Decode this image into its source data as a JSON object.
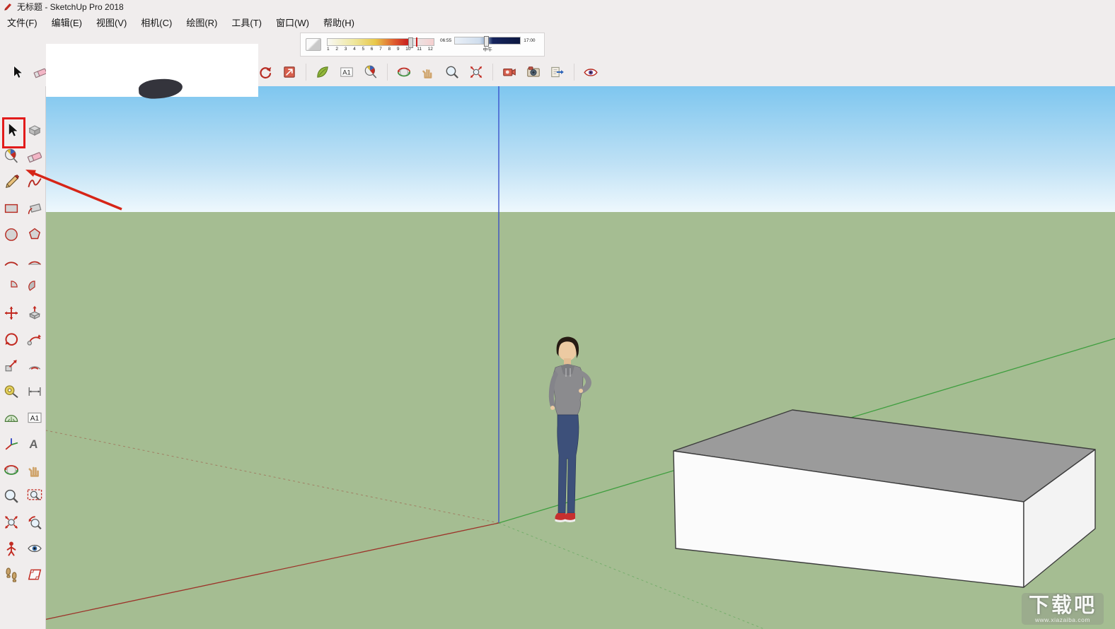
{
  "window": {
    "title": "无标题 - SketchUp Pro 2018"
  },
  "menu": {
    "items": [
      {
        "id": "file",
        "label": "文件(F)"
      },
      {
        "id": "edit",
        "label": "编辑(E)"
      },
      {
        "id": "view",
        "label": "视图(V)"
      },
      {
        "id": "camera",
        "label": "相机(C)"
      },
      {
        "id": "draw",
        "label": "绘图(R)"
      },
      {
        "id": "tools",
        "label": "工具(T)"
      },
      {
        "id": "window",
        "label": "窗口(W)"
      },
      {
        "id": "help",
        "label": "帮助(H)"
      }
    ]
  },
  "shadow_toolbar": {
    "months": [
      "1",
      "2",
      "3",
      "4",
      "5",
      "6",
      "7",
      "8",
      "9",
      "10",
      "11",
      "12"
    ],
    "time_start": "06:55",
    "noon_label": "中午",
    "time_end": "17:00"
  },
  "top_toolbar": {
    "icons": [
      "select",
      "eraser",
      "--",
      "redo",
      "export-box",
      "|",
      "leaf",
      "text-a1",
      "bucket",
      "|",
      "orbit",
      "pan",
      "zoom",
      "zoom-extents",
      "|",
      "camera-red",
      "camera-face",
      "export-arrow",
      "|",
      "eye"
    ]
  },
  "left_toolbar": {
    "rows": [
      [
        "select",
        "component"
      ],
      [
        "bucket",
        "eraser"
      ],
      [
        "pencil",
        "freehand"
      ],
      [
        "rect",
        "rotated-rect"
      ],
      [
        "circle",
        "polygon"
      ],
      [
        "arc",
        "arc2"
      ],
      [
        "pie",
        "pie2"
      ],
      [
        "move",
        "push-pull"
      ],
      [
        "rotate",
        "follow-me"
      ],
      [
        "scale",
        "offset"
      ],
      [
        "tape",
        "dimension"
      ],
      [
        "protractor",
        "text-a1"
      ],
      [
        "axes",
        "text-3d"
      ],
      [
        "orbit",
        "pan"
      ],
      [
        "zoom",
        "zoom-window"
      ],
      [
        "zoom-extents",
        "previous-view"
      ],
      [
        "position-camera",
        "look-around"
      ],
      [
        "walk",
        "section-plane"
      ]
    ]
  },
  "scene": {
    "colors": {
      "sky_top": "#7ec6ef",
      "sky_bottom": "#eef8fd",
      "ground": "#a5bd92",
      "axis_blue": "#3349c8",
      "axis_green": "#3f9e3f",
      "axis_red": "#9c342a",
      "box_top": "#9b9b9b",
      "box_front": "#fbfbfb",
      "box_side": "#f3f3f3",
      "edge": "#3c3c3c",
      "annotation": "#e21b1b"
    }
  },
  "watermark": {
    "title": "下载吧",
    "subtitle": "www.xiazaiba.com"
  }
}
